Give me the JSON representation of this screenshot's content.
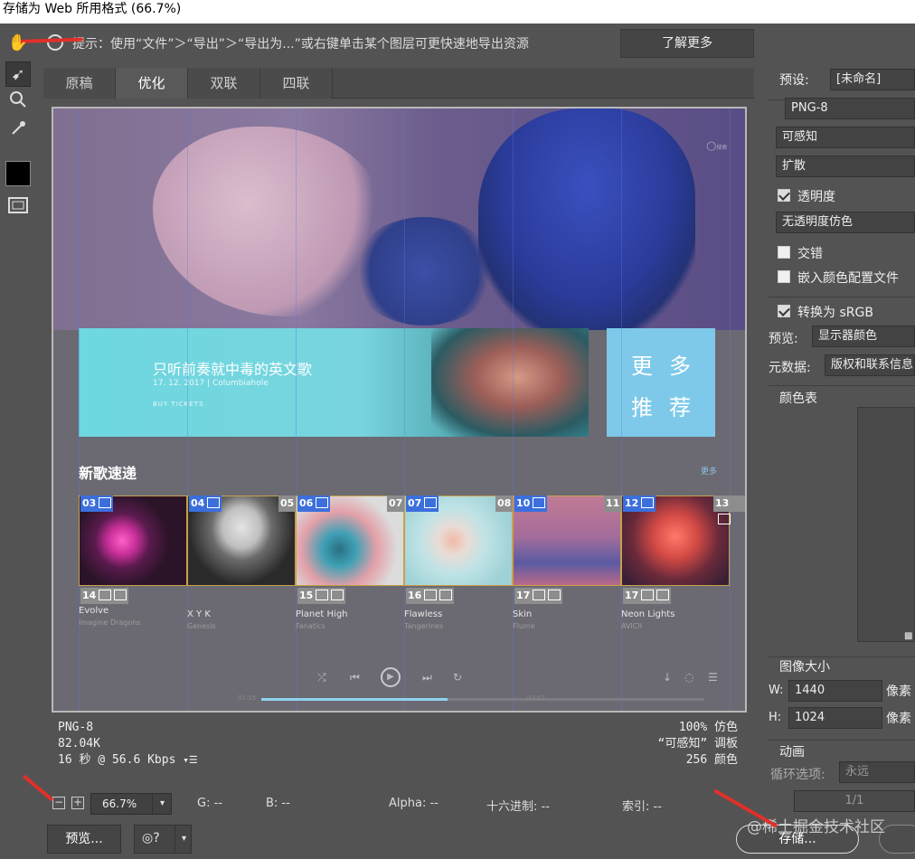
{
  "window": {
    "title": "存储为 Web 所用格式 (66.7%)"
  },
  "hint": {
    "text": "提示：使用“文件”＞“导出”＞“导出为...”或右键单击某个图层可更快速地导出资源",
    "learn_more": "了解更多"
  },
  "tools": [
    "hand-icon",
    "slice-select-icon",
    "zoom-icon",
    "eyedropper-icon",
    "color-swatch",
    "slice-visibility-icon"
  ],
  "tabs": [
    {
      "label": "原稿",
      "active": false
    },
    {
      "label": "优化",
      "active": true
    },
    {
      "label": "双联",
      "active": false
    },
    {
      "label": "四联",
      "active": false
    }
  ],
  "canvas": {
    "search_label": "搜索",
    "banner": {
      "title": "只听前奏就中毒的英文歌",
      "date": "17. 12. 2017 | Columbiahole",
      "buy": "BUY TICKETS"
    },
    "more": {
      "line1": "更多",
      "line2": "推荐"
    },
    "section_title": "新歌速递",
    "section_more": "更多",
    "top_slices": [
      "03",
      "04",
      "05",
      "06",
      "07",
      "08",
      "10",
      "11",
      "12",
      "13"
    ],
    "bottom_slices": [
      "14",
      "15",
      "16",
      "17",
      "17"
    ],
    "songs": [
      {
        "name": "Evolve",
        "artist": "Imagine Dragons"
      },
      {
        "name": "X Y K",
        "artist": "Genesis"
      },
      {
        "name": "Planet High",
        "artist": "Fanatics"
      },
      {
        "name": "Flawless",
        "artist": "Tangerines"
      },
      {
        "name": "Skin",
        "artist": "Flume"
      },
      {
        "name": "Neon Lights",
        "artist": "AVICII"
      }
    ],
    "time_start": "01:15",
    "time_end": "03:07",
    "progress": 0.42
  },
  "status": {
    "format": "PNG-8",
    "size": "82.04K",
    "speed": "16 秒 @ 56.6 Kbps",
    "dither": "100% 仿色",
    "palette": "“可感知” 调板",
    "colors": "256 颜色"
  },
  "bottom": {
    "zoom": "66.7%",
    "g": "G: --",
    "b": "B: --",
    "alpha": "Alpha: --",
    "hex": "十六进制: --",
    "index": "索引: --",
    "preview": "预览...",
    "save": "存储...",
    "watermark": "@稀土掘金技术社区"
  },
  "settings": {
    "preset_label": "预设:",
    "preset_value": "[未命名]",
    "format": "PNG-8",
    "reduction": "可感知",
    "dither": "扩散",
    "transparency": {
      "label": "透明度",
      "checked": true
    },
    "matte": "无透明度仿色",
    "interlaced": {
      "label": "交错",
      "checked": false
    },
    "embed_profile": {
      "label": "嵌入颜色配置文件",
      "checked": false
    },
    "srgb": {
      "label": "转换为 sRGB",
      "checked": true
    },
    "preview_label": "预览:",
    "preview_value": "显示器颜色",
    "metadata_label": "元数据:",
    "metadata_value": "版权和联系信息",
    "color_table": "颜色表",
    "image_size": "图像大小",
    "w_label": "W:",
    "w_value": "1440",
    "h_label": "H:",
    "h_value": "1024",
    "unit": "像素",
    "animation": "动画",
    "loop_label": "循环选项:",
    "loop_value": "永远",
    "frame": "1/1"
  },
  "colors": {
    "accent_arrow": "#e0302a",
    "slice_blue": "#3b6fdc",
    "banner_teal": "#6ed7e0",
    "more_blue": "#7ec9e9"
  }
}
